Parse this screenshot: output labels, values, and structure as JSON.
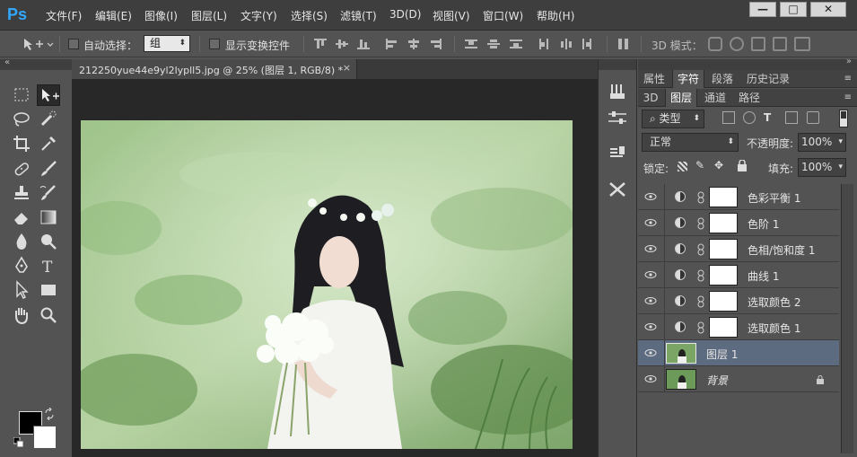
{
  "app": {
    "logo": "Ps"
  },
  "menu": {
    "items": [
      "文件(F)",
      "编辑(E)",
      "图像(I)",
      "图层(L)",
      "文字(Y)",
      "选择(S)",
      "滤镜(T)",
      "3D(D)",
      "视图(V)",
      "窗口(W)",
      "帮助(H)"
    ]
  },
  "window_controls": {
    "minimize": "—",
    "maximize": "□",
    "close": "✕"
  },
  "options": {
    "auto_select_label": "自动选择：",
    "auto_select_value": "组",
    "show_transform_label": "显示变换控件",
    "mode_3d_label": "3D 模式："
  },
  "document": {
    "tab_title": "212250yue44e9yl2lypll5.jpg @ 25% (图层 1, RGB/8) *",
    "tab_close": "×"
  },
  "panels": {
    "top_tabs": [
      "属性",
      "字符",
      "段落",
      "历史记录"
    ],
    "layer_tabs": [
      "3D",
      "图层",
      "通道",
      "路径"
    ],
    "filter_kind": "类型",
    "blend_mode": "正常",
    "opacity_label": "不透明度:",
    "opacity_value": "100%",
    "lock_label": "锁定:",
    "fill_label": "填充:",
    "fill_value": "100%"
  },
  "layers": [
    {
      "name": "色彩平衡 1",
      "type": "adjustment"
    },
    {
      "name": "色阶 1",
      "type": "adjustment"
    },
    {
      "name": "色相/饱和度 1",
      "type": "adjustment"
    },
    {
      "name": "曲线 1",
      "type": "adjustment"
    },
    {
      "name": "选取颜色 2",
      "type": "adjustment"
    },
    {
      "name": "选取颜色 1",
      "type": "adjustment"
    },
    {
      "name": "图层 1",
      "type": "pixel",
      "selected": true
    },
    {
      "name": "背景",
      "type": "background",
      "locked": true
    }
  ],
  "colors": {
    "foreground": "#000000",
    "background": "#ffffff",
    "selection": "#5d6b80",
    "ps_blue": "#31a8ff"
  }
}
